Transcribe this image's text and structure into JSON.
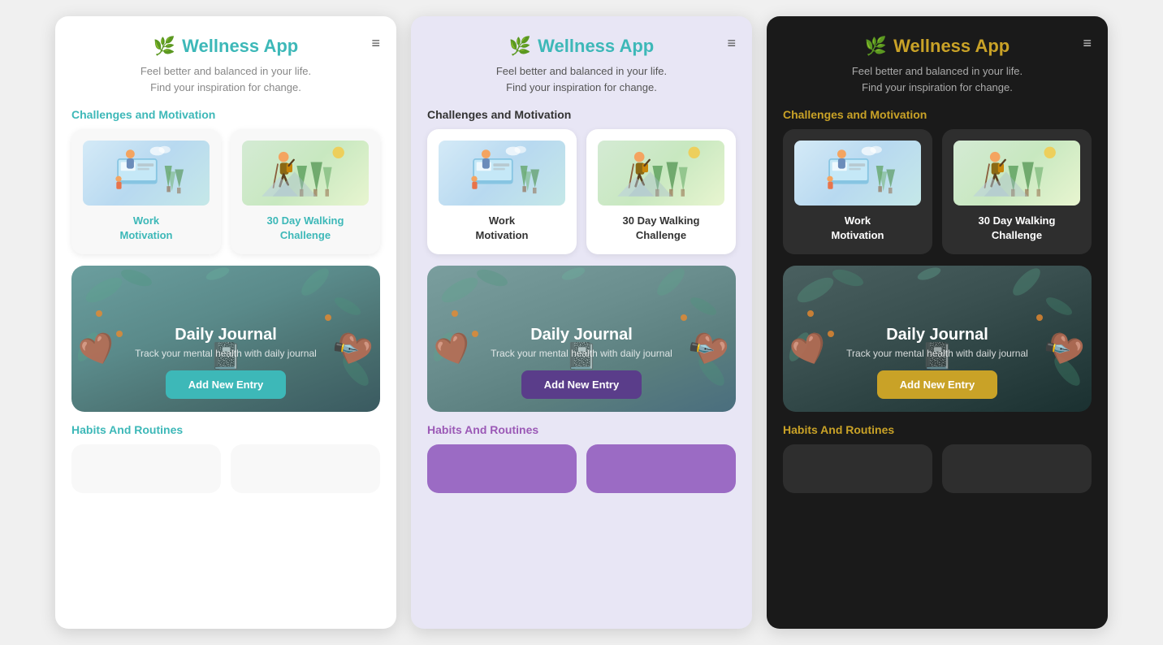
{
  "panels": [
    {
      "id": "light",
      "theme": "light",
      "header": {
        "title": "Wellness App",
        "tagline": "Feel better and balanced in your life.\nFind your inspiration for change.",
        "menu_label": "≡"
      },
      "challenges_section": {
        "label": "Challenges and Motivation"
      },
      "cards": [
        {
          "label": "Work\nMotivation",
          "type": "work"
        },
        {
          "label": "30 Day Walking\nChallenge",
          "type": "walking"
        }
      ],
      "journal": {
        "title": "Daily Journal",
        "subtitle": "Track your mental health with daily journal",
        "button_label": "Add New Entry"
      },
      "habits": {
        "label": "Habits And Routines"
      }
    },
    {
      "id": "purple",
      "theme": "purple",
      "header": {
        "title": "Wellness App",
        "tagline": "Feel better and balanced in your life.\nFind your inspiration for change.",
        "menu_label": "≡"
      },
      "challenges_section": {
        "label": "Challenges and Motivation"
      },
      "cards": [
        {
          "label": "Work\nMotivation",
          "type": "work"
        },
        {
          "label": "30 Day Walking\nChallenge",
          "type": "walking"
        }
      ],
      "journal": {
        "title": "Daily Journal",
        "subtitle": "Track your mental health with daily journal",
        "button_label": "Add New Entry"
      },
      "habits": {
        "label": "Habits And Routines"
      }
    },
    {
      "id": "dark",
      "theme": "dark",
      "header": {
        "title": "Wellness App",
        "tagline": "Feel better and balanced in your life.\nFind your inspiration for change.",
        "menu_label": "≡"
      },
      "challenges_section": {
        "label": "Challenges and Motivation"
      },
      "cards": [
        {
          "label": "Work\nMotivation",
          "type": "work"
        },
        {
          "label": "30 Day Walking\nChallenge",
          "type": "walking"
        }
      ],
      "journal": {
        "title": "Daily Journal",
        "subtitle": "Track your mental health with daily journal",
        "button_label": "Add New Entry"
      },
      "habits": {
        "label": "Habits And Routines"
      }
    }
  ]
}
